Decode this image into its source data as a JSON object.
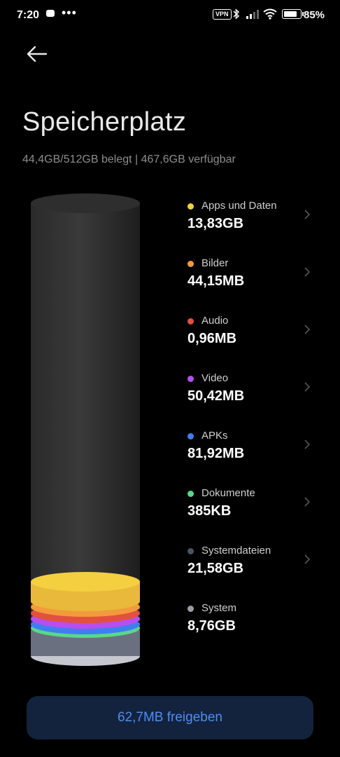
{
  "status": {
    "time": "7:20",
    "dots": "•••",
    "vpn": "VPN",
    "battery": "85%"
  },
  "header": {
    "title": "Speicherplatz",
    "summary": "44,4GB/512GB belegt | 467,6GB verfügbar"
  },
  "categories": [
    {
      "label": "Apps und Daten",
      "size": "13,83GB",
      "color": "#f4cf3f",
      "clickable": true
    },
    {
      "label": "Bilder",
      "size": "44,15MB",
      "color": "#f39a3c",
      "clickable": true
    },
    {
      "label": "Audio",
      "size": "0,96MB",
      "color": "#e3503d",
      "clickable": true
    },
    {
      "label": "Video",
      "size": "50,42MB",
      "color": "#b64ef0",
      "clickable": true
    },
    {
      "label": "APKs",
      "size": "81,92MB",
      "color": "#3f7ef0",
      "clickable": true
    },
    {
      "label": "Dokumente",
      "size": "385KB",
      "color": "#59d88a",
      "clickable": true
    },
    {
      "label": "Systemdateien",
      "size": "21,58GB",
      "color": "#4b5368",
      "clickable": true
    },
    {
      "label": "System",
      "size": "8,76GB",
      "color": "#9a9eaa",
      "clickable": false
    }
  ],
  "action": {
    "free_label": "62,7MB freigeben"
  }
}
